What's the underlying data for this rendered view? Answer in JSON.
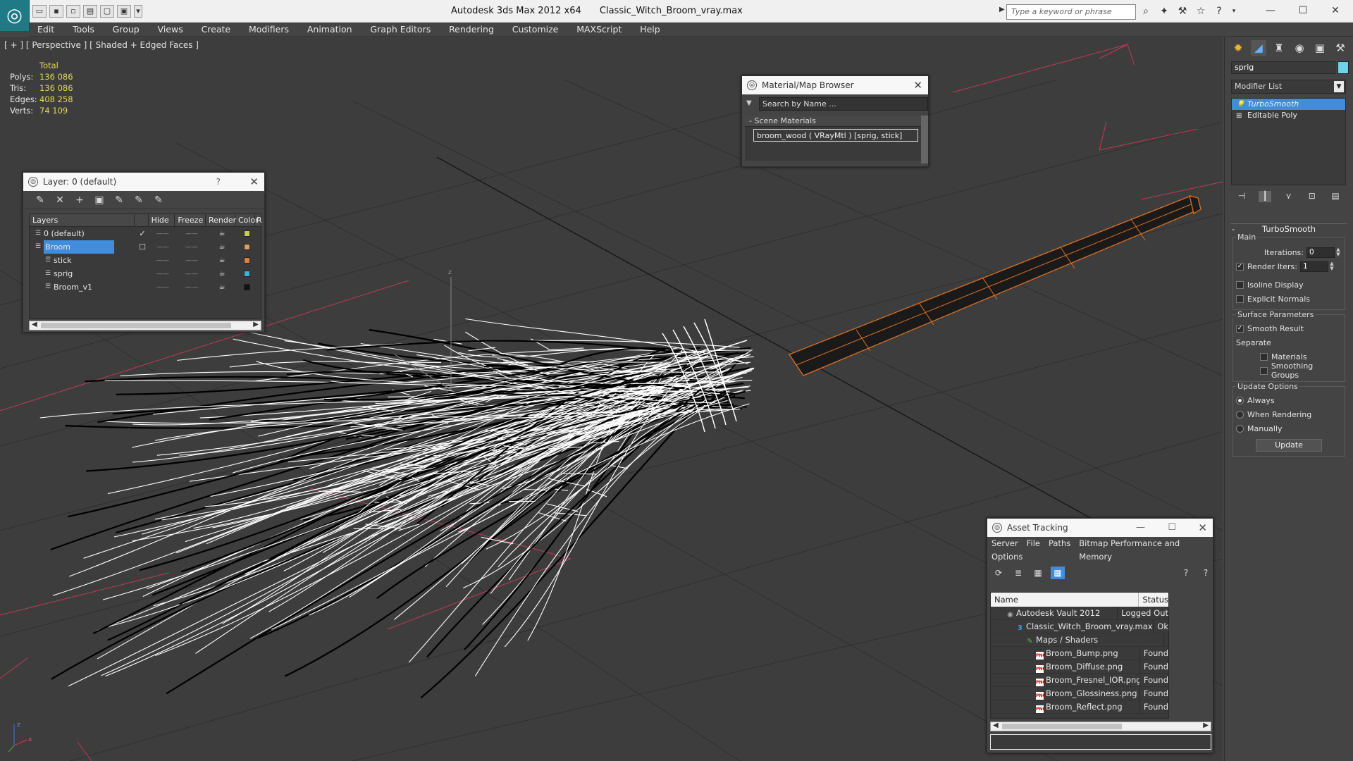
{
  "titlebar": {
    "app_title": "Autodesk 3ds Max  2012 x64",
    "file_name": "Classic_Witch_Broom_vray.max",
    "search_placeholder": "Type a keyword or phrase"
  },
  "menu": [
    "Edit",
    "Tools",
    "Group",
    "Views",
    "Create",
    "Modifiers",
    "Animation",
    "Graph Editors",
    "Rendering",
    "Customize",
    "MAXScript",
    "Help"
  ],
  "viewport": {
    "label": "[ + ] [ Perspective ] [ Shaded + Edged Faces ]",
    "stats": {
      "header": "Total",
      "rows": [
        {
          "label": "Polys:",
          "value": "136 086"
        },
        {
          "label": "Tris:",
          "value": "136 086"
        },
        {
          "label": "Edges:",
          "value": "408 258"
        },
        {
          "label": "Verts:",
          "value": "74 109"
        }
      ]
    },
    "axis_labels": {
      "x": "x",
      "z": "z"
    }
  },
  "layer_window": {
    "title": "Layer: 0 (default)",
    "help": "?",
    "columns": [
      "Layers",
      "Hide",
      "Freeze",
      "Render",
      "Color",
      "R"
    ],
    "rows": [
      {
        "name": "0 (default)",
        "check": "✓",
        "color": "#c8d43a",
        "indent": false,
        "selected": false
      },
      {
        "name": "Broom",
        "check": "☐",
        "color": "#e2a060",
        "indent": false,
        "selected": true
      },
      {
        "name": "stick",
        "check": "",
        "color": "#e08040",
        "indent": true,
        "selected": false
      },
      {
        "name": "sprig",
        "check": "",
        "color": "#35b8d8",
        "indent": true,
        "selected": false
      },
      {
        "name": "Broom_v1",
        "check": "",
        "color": "#111111",
        "indent": true,
        "selected": false
      }
    ]
  },
  "material_browser": {
    "title": "Material/Map Browser",
    "search_placeholder": "Search by Name ...",
    "section": "Scene Materials",
    "item": "broom_wood  ( VRayMtl ) [sprig, stick]"
  },
  "command_panel": {
    "object_name": "sprig",
    "object_color": "#6cd4e8",
    "modifier_list_label": "Modifier List",
    "stack": [
      {
        "label": "TurboSmooth",
        "selected": true
      },
      {
        "label": "Editable Poly",
        "selected": false
      }
    ],
    "rollout_title": "TurboSmooth",
    "main_label": "Main",
    "iterations_label": "Iterations:",
    "iterations_value": "0",
    "render_iters_label": "Render Iters:",
    "render_iters_value": "1",
    "isoline_label": "Isoline Display",
    "explicit_normals_label": "Explicit Normals",
    "surface_label": "Surface Parameters",
    "smooth_result_label": "Smooth Result",
    "separate_label": "Separate",
    "materials_label": "Materials",
    "smoothing_groups_label": "Smoothing Groups",
    "update_options_label": "Update Options",
    "always_label": "Always",
    "when_rendering_label": "When Rendering",
    "manually_label": "Manually",
    "update_button": "Update"
  },
  "asset_tracking": {
    "title": "Asset Tracking",
    "menu": [
      "Server",
      "File",
      "Paths",
      "Bitmap Performance and Memory"
    ],
    "menu2": "Options",
    "columns": [
      "Name",
      "Status"
    ],
    "rows": [
      {
        "name": "Autodesk Vault 2012",
        "status": "Logged Out",
        "level": 1,
        "icon": "vault"
      },
      {
        "name": "Classic_Witch_Broom_vray.max",
        "status": "Ok",
        "level": 2,
        "icon": "max"
      },
      {
        "name": "Maps / Shaders",
        "status": "",
        "level": 3,
        "icon": "maps"
      },
      {
        "name": "Broom_Bump.png",
        "status": "Found",
        "level": 4,
        "icon": "png"
      },
      {
        "name": "Broom_Diffuse.png",
        "status": "Found",
        "level": 4,
        "icon": "png"
      },
      {
        "name": "Broom_Fresnel_IOR.png",
        "status": "Found",
        "level": 4,
        "icon": "png"
      },
      {
        "name": "Broom_Glossiness.png",
        "status": "Found",
        "level": 4,
        "icon": "png"
      },
      {
        "name": "Broom_Reflect.png",
        "status": "Found",
        "level": 4,
        "icon": "png"
      }
    ]
  },
  "colors": {
    "selection": "#3f8ddc",
    "stats_value": "#e4d85a",
    "stick_wire": "#e07020",
    "bristle_wire": "#ffffff"
  }
}
